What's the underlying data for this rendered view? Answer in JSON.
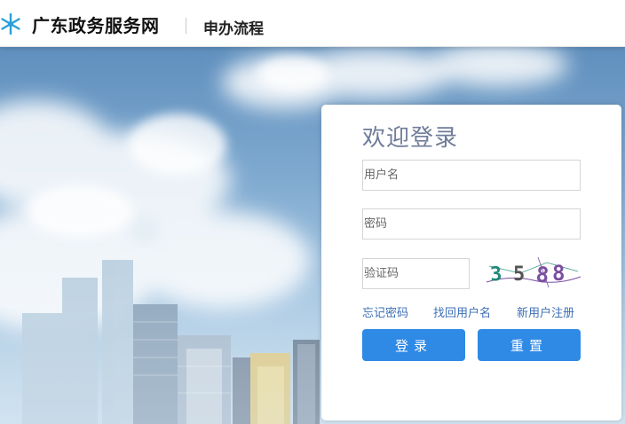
{
  "header": {
    "site_title": "广东政务服务网",
    "nav_link": "申办流程",
    "logo_icon": "snowflake-logo-icon"
  },
  "login": {
    "title": "欢迎登录",
    "username_placeholder": "用户名",
    "password_placeholder": "密码",
    "captcha_placeholder": "验证码",
    "captcha_text": "3588",
    "links": {
      "forgot_password": "忘记密码",
      "forgot_username": "找回用户名",
      "register": "新用户注册"
    },
    "buttons": {
      "login": "登录",
      "reset": "重置"
    }
  },
  "colors": {
    "accent": "#2f8ae6",
    "link": "#3d6fb6",
    "title": "#6f7c99",
    "logo": "#2aa0d8"
  }
}
